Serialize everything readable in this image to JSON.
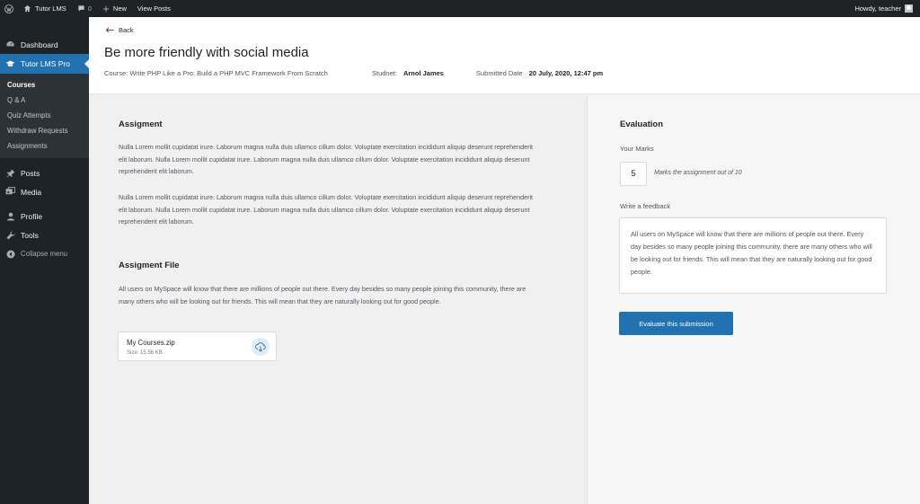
{
  "adminbar": {
    "site_name": "Tutor LMS",
    "comments_count": "0",
    "new_label": "New",
    "view_posts_label": "View Posts",
    "howdy": "Howdy, teacher"
  },
  "sidebar": {
    "dashboard": "Dashboard",
    "tutor": "Tutor LMS Pro",
    "submenu": [
      "Courses",
      "Q & A",
      "Quiz Attempts",
      "Withdraw Requests",
      "Assignments"
    ],
    "posts": "Posts",
    "media": "Media",
    "profile": "Profile",
    "tools": "Tools",
    "collapse": "Collapse menu"
  },
  "header": {
    "back": "Back",
    "title": "Be more friendly with social media",
    "course": "Course: Write PHP Like a Pro: Build a PHP MVC Framework From Scratch",
    "student_label": "Studnet:",
    "student_name": "Arnol James",
    "date_label": "Submitted Date",
    "date_value": "20 July, 2020, 12:47 pm"
  },
  "assignment": {
    "title": "Assigment",
    "para1": "Nulla Lorem mollit cupidatat irure. Laborum magna nulla duis ullamco cillum dolor. Voluptate exercitation incididunt aliquip deserunt reprehenderit elit laborum. Nulla Lorem mollit cupidatat irure. Laborum magna nulla duis ullamco cillum dolor. Voluptate exercitation incididunt aliquip deserunt reprehenderit elit laborum.",
    "para2": "Nulla Lorem mollit cupidatat irure. Laborum magna nulla duis ullamco cillum dolor. Voluptate exercitation incididunt aliquip deserunt reprehenderit elit laborum. Nulla Lorem mollit cupidatat irure. Laborum magna nulla duis ullamco cillum dolor. Voluptate exercitation incididunt aliquip deserunt reprehenderit elit laborum."
  },
  "assignment_file": {
    "title": "Assigment File",
    "description": "All users on MySpace will know that there are millions of people out there. Every day besides so many people joining this community, there are many others who will be looking out for friends. This will mean that they are naturally looking out for good people.",
    "file_name": "My Courses.zip",
    "file_size": "Size: 15.56 KB"
  },
  "evaluation": {
    "title": "Evaluation",
    "marks_label": "Your Marks",
    "marks_value": "5",
    "marks_hint": "Marks the assignment out of 10",
    "feedback_label": "Write a feedback",
    "feedback_text": "All users on MySpace will know that there are millions of people out there. Every day besides so many people joining this community, there are many others who will be looking out for friends. This will mean that they are naturally looking out for good people.",
    "button": "Evaluate this submission"
  },
  "colors": {
    "admin_dark": "#1d2327",
    "accent": "#2271b1"
  }
}
